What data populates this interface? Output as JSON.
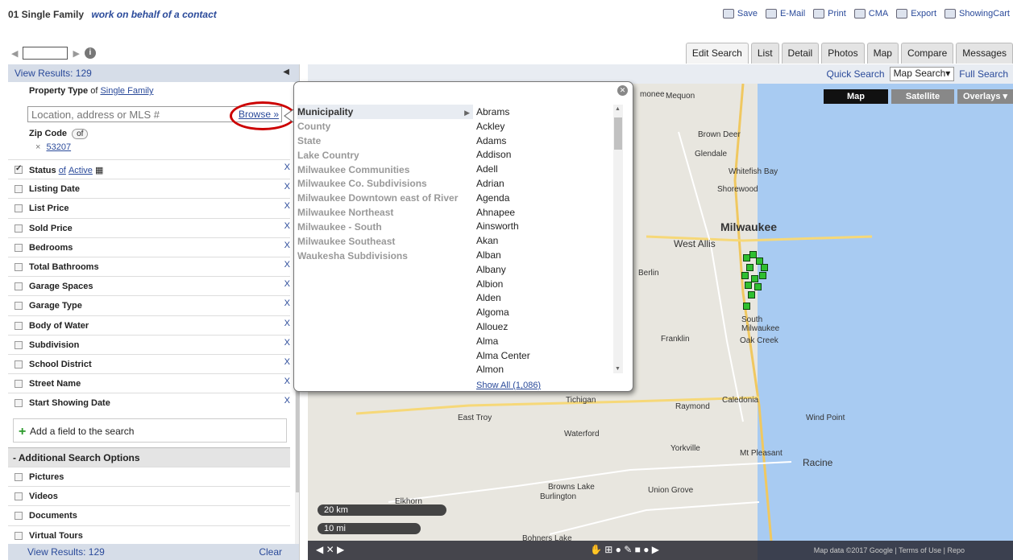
{
  "header": {
    "title": "01 Single Family",
    "subtitle": "work on behalf of a contact",
    "actions": [
      "Save",
      "E-Mail",
      "Print",
      "CMA",
      "Export",
      "ShowingCart"
    ]
  },
  "tabs": [
    "Edit Search",
    "List",
    "Detail",
    "Photos",
    "Map",
    "Compare",
    "Messages"
  ],
  "left": {
    "view_results": "View Results: 129",
    "property_type_label": "Property Type",
    "property_type_of": "of",
    "property_type_value": "Single Family",
    "location_placeholder": "Location, address or MLS #",
    "browse": "Browse »",
    "zip_label": "Zip Code",
    "zip_of": "of",
    "zip_value": "53207",
    "fields": [
      {
        "label": "Status",
        "of": "of",
        "value": "Active",
        "checked": true
      },
      {
        "label": "Listing Date"
      },
      {
        "label": "List Price"
      },
      {
        "label": "Sold Price"
      },
      {
        "label": "Bedrooms"
      },
      {
        "label": "Total Bathrooms"
      },
      {
        "label": "Garage Spaces"
      },
      {
        "label": "Garage Type"
      },
      {
        "label": "Body of Water"
      },
      {
        "label": "Subdivision"
      },
      {
        "label": "School District"
      },
      {
        "label": "Street Name"
      },
      {
        "label": "Start Showing Date"
      }
    ],
    "remove": "X",
    "add_field": "Add a field to the search",
    "additional_header": "- Additional Search Options",
    "options": [
      "Pictures",
      "Videos",
      "Documents",
      "Virtual Tours"
    ],
    "bottom_results": "View Results: 129",
    "clear": "Clear"
  },
  "map": {
    "subnav": [
      "Quick Search",
      "Map Search▾",
      "Full Search"
    ],
    "types": [
      "Map",
      "Satellite",
      "Overlays ▾"
    ],
    "cities": [
      "Mequon",
      "Brown Deer",
      "Glendale",
      "Whitefish Bay",
      "Shorewood",
      "Milwaukee",
      "West Allis",
      "Berlin",
      "South Milwaukee",
      "Franklin",
      "Oak Creek",
      "Caledonia",
      "Raymond",
      "Wind Point",
      "Tichigan",
      "East Troy",
      "Waterford",
      "Yorkville",
      "Mt Pleasant",
      "Racine",
      "Burlington",
      "Browns Lake",
      "Union Grove",
      "Elkhorn",
      "Bohners Lake",
      "monee"
    ],
    "scale_km": "20 km",
    "scale_mi": "10 mi",
    "credits": "Map data ©2017 Google | Terms of Use | Repo"
  },
  "popup": {
    "categories": [
      "Municipality",
      "County",
      "State",
      "Lake Country",
      "Milwaukee Communities",
      "Milwaukee Co. Subdivisions",
      "Milwaukee Downtown east of River",
      "Milwaukee Northeast",
      "Milwaukee - South",
      "Milwaukee Southeast",
      "Waukesha Subdivisions"
    ],
    "municipalities": [
      "Abrams",
      "Ackley",
      "Adams",
      "Addison",
      "Adell",
      "Adrian",
      "Agenda",
      "Ahnapee",
      "Ainsworth",
      "Akan",
      "Alban",
      "Albany",
      "Albion",
      "Alden",
      "Algoma",
      "Allouez",
      "Alma",
      "Alma Center",
      "Almon"
    ],
    "show_all": "Show All (1,086)"
  },
  "colors": {
    "accent": "#2a4a9a",
    "lake": "#a8cbf2",
    "marker": "#2fbf2f",
    "highlight": "#c00000"
  }
}
